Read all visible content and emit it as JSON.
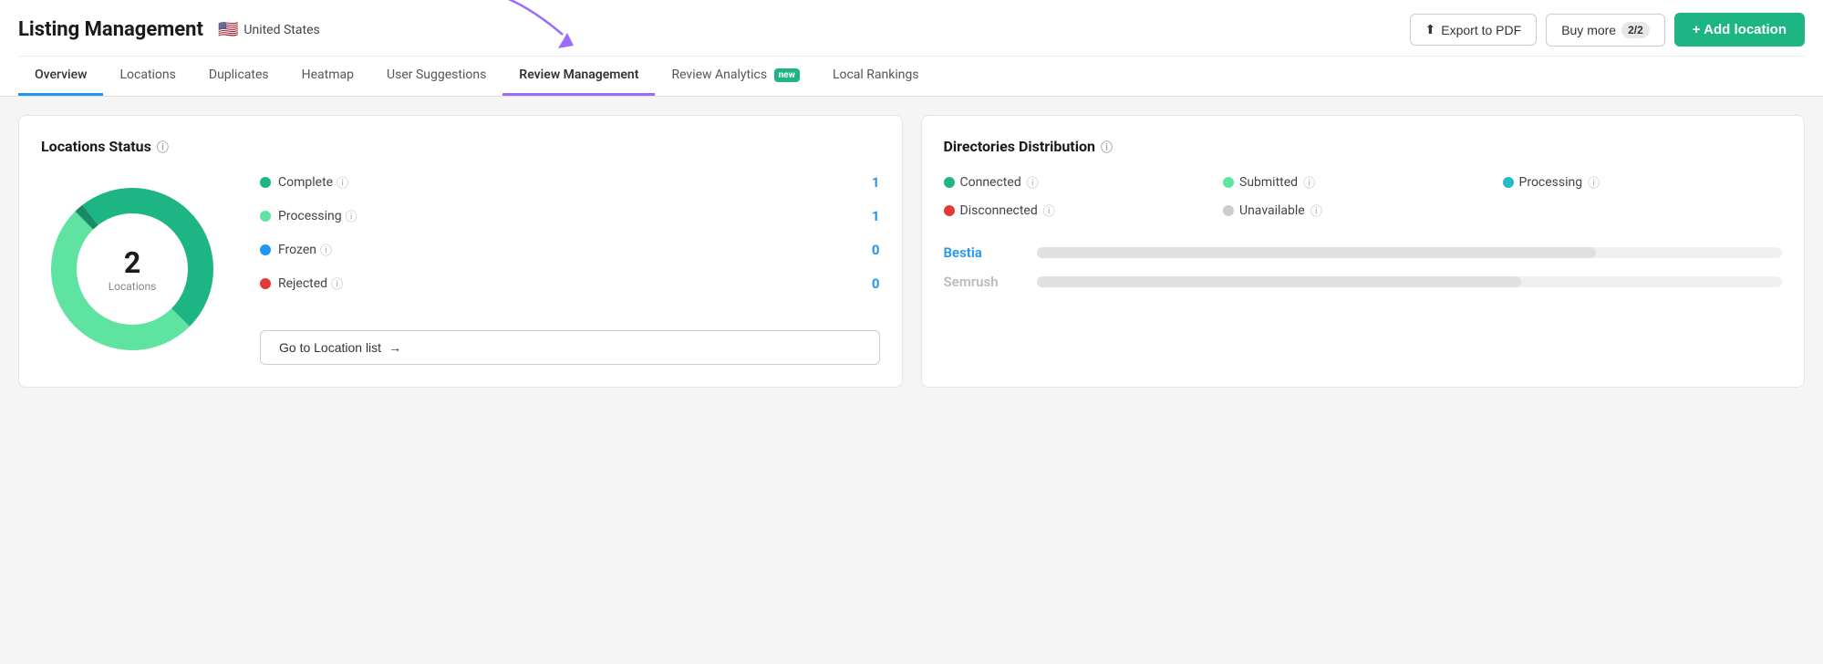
{
  "header": {
    "app_title": "Listing Management",
    "country": "United States",
    "flag": "🇺🇸",
    "export_label": "Export to PDF",
    "buy_more_label": "Buy more",
    "buy_more_count": "2/2",
    "add_location_label": "+ Add location"
  },
  "nav": {
    "tabs": [
      {
        "id": "overview",
        "label": "Overview",
        "state": "active-blue"
      },
      {
        "id": "locations",
        "label": "Locations",
        "state": "normal"
      },
      {
        "id": "duplicates",
        "label": "Duplicates",
        "state": "normal"
      },
      {
        "id": "heatmap",
        "label": "Heatmap",
        "state": "normal"
      },
      {
        "id": "user-suggestions",
        "label": "User Suggestions",
        "state": "normal"
      },
      {
        "id": "review-management",
        "label": "Review Management",
        "state": "active-purple"
      },
      {
        "id": "review-analytics",
        "label": "Review Analytics",
        "state": "normal"
      },
      {
        "id": "local-rankings",
        "label": "Local Rankings",
        "state": "normal"
      }
    ]
  },
  "locations_status": {
    "title": "Locations Status",
    "total": "2",
    "total_label": "Locations",
    "statuses": [
      {
        "label": "Complete",
        "dot": "dot-green",
        "count": "1"
      },
      {
        "label": "Processing",
        "dot": "dot-light-green",
        "count": "1"
      },
      {
        "label": "Frozen",
        "dot": "dot-blue",
        "count": "0"
      },
      {
        "label": "Rejected",
        "dot": "dot-red",
        "count": "0"
      }
    ],
    "goto_button": "Go to Location list",
    "goto_arrow": "→"
  },
  "directories": {
    "title": "Directories Distribution",
    "legend": [
      {
        "label": "Connected",
        "dot": "dot-green"
      },
      {
        "label": "Submitted",
        "dot": "dot-light-green"
      },
      {
        "label": "Processing",
        "dot": "dot-teal"
      },
      {
        "label": "Disconnected",
        "dot": "dot-red"
      },
      {
        "label": "Unavailable",
        "dot": "dot-gray"
      }
    ],
    "locations": [
      {
        "name": "Bestia",
        "active": true,
        "bar_width": "75",
        "bar_color": "#e0e0e0"
      },
      {
        "name": "Semrush",
        "active": false,
        "bar_width": "65",
        "bar_color": "#e0e0e0"
      }
    ]
  },
  "donut": {
    "complete_color": "#1db584",
    "processing_color": "#5fe3a1",
    "complete_pct": 50,
    "processing_pct": 50
  }
}
